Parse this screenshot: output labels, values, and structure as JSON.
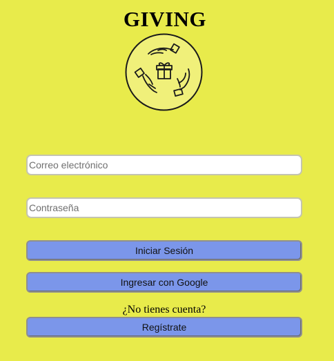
{
  "app": {
    "title": "GIVING"
  },
  "logo": {
    "icon": "giving-hands-gift-icon"
  },
  "form": {
    "email_placeholder": "Correo electrónico",
    "password_placeholder": "Contraseña",
    "login_label": "Iniciar Sesión",
    "google_label": "Ingresar con Google",
    "no_account_text": "¿No tienes cuenta?",
    "register_label": "Regístrate"
  },
  "colors": {
    "background": "#e8eb4b",
    "button": "#7b96ea",
    "logo_fill": "#f0f07a"
  }
}
